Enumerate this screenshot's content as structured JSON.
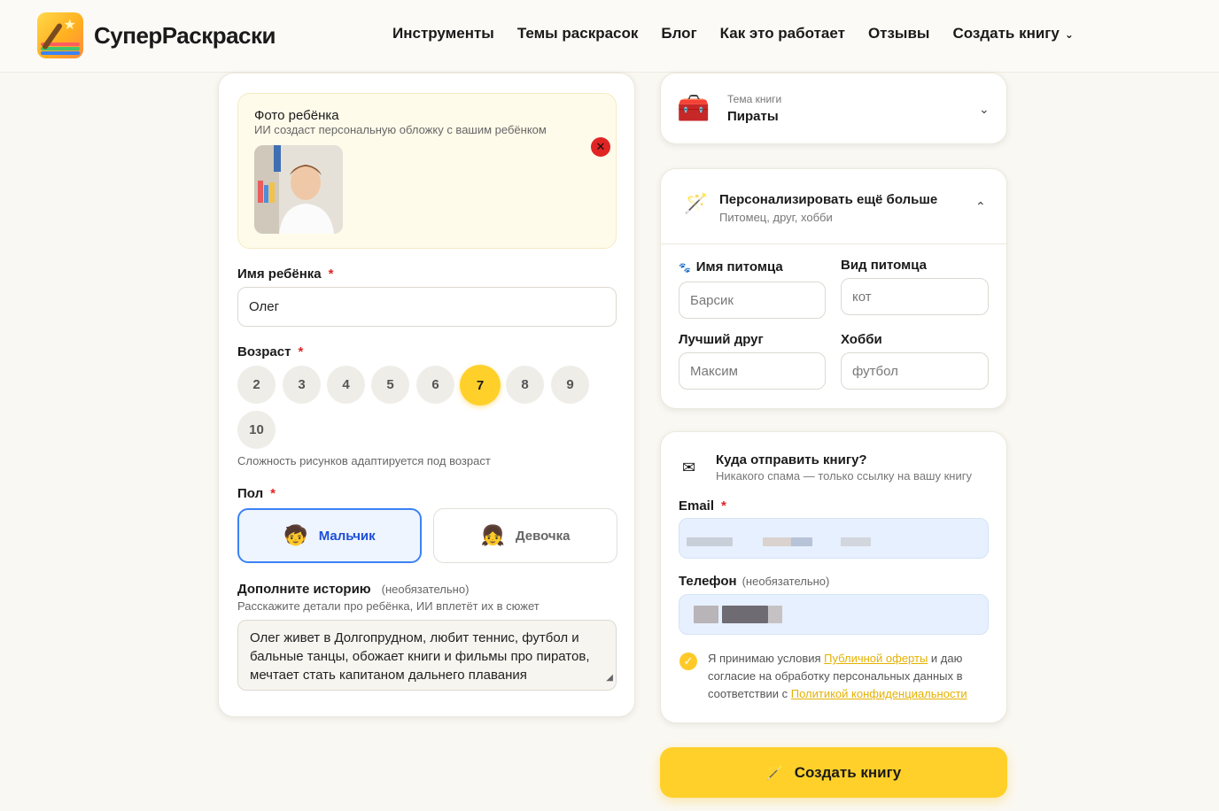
{
  "header": {
    "logo_text": "СуперРаскраски",
    "nav": [
      {
        "label": "Инструменты"
      },
      {
        "label": "Темы раскрасок"
      },
      {
        "label": "Блог"
      },
      {
        "label": "Как это работает"
      },
      {
        "label": "Отзывы"
      },
      {
        "label": "Создать книгу"
      }
    ]
  },
  "photo": {
    "title": "Фото ребёнка",
    "subtitle": "ИИ создаст персональную обложку с вашим ребёнком"
  },
  "name_field": {
    "label": "Имя ребёнка",
    "value": "Олег"
  },
  "age": {
    "label": "Возраст",
    "options": [
      "2",
      "3",
      "4",
      "5",
      "6",
      "7",
      "8",
      "9",
      "10"
    ],
    "selected": "7",
    "hint": "Сложность рисунков адаптируется под возраст"
  },
  "gender": {
    "label": "Пол",
    "boy": "Мальчик",
    "girl": "Девочка",
    "selected": "boy"
  },
  "story": {
    "label": "Дополните историю",
    "optional": "(необязательно)",
    "hint": "Расскажите детали про ребёнка, ИИ вплетёт их в сюжет",
    "value": "Олег живет в Долгопрудном, любит теннис, футбол и бальные танцы, обожает книги и фильмы про пиратов, мечтает стать капитаном дальнего плавания"
  },
  "theme": {
    "label": "Тема книги",
    "value": "Пираты"
  },
  "personalize": {
    "title": "Персонализировать ещё больше",
    "subtitle": "Питомец, друг, хобби",
    "pet_name_label": "Имя питомца",
    "pet_name_placeholder": "Барсик",
    "pet_type_label": "Вид питомца",
    "pet_type_placeholder": "кот",
    "friend_label": "Лучший друг",
    "friend_placeholder": "Максим",
    "hobby_label": "Хобби",
    "hobby_placeholder": "футбол"
  },
  "delivery": {
    "title": "Куда отправить книгу?",
    "subtitle": "Никакого спама — только ссылку на вашу книгу",
    "email_label": "Email",
    "phone_label": "Телефон",
    "phone_optional": "(необязательно)",
    "consent_1": "Я принимаю условия ",
    "consent_link1": "Публичной оферты",
    "consent_2": " и даю согласие на обработку персональных данных в соответствии с ",
    "consent_link2": "Политикой конфиденциальности"
  },
  "submit": {
    "label": "Создать книгу"
  },
  "colors": {
    "accent": "#ffd02a",
    "selected_blue": "#3b82f6",
    "required": "#e02424"
  }
}
